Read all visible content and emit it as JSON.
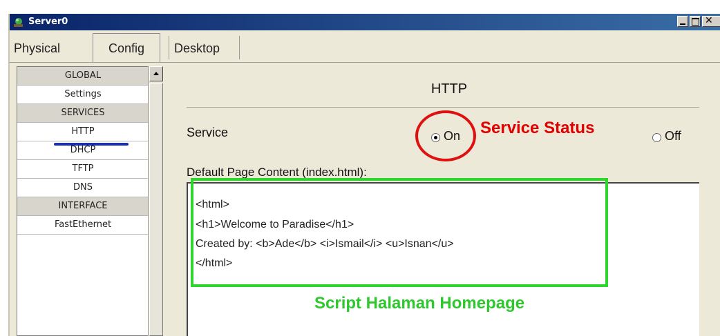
{
  "window": {
    "title": "Server0",
    "icon": "server-icon",
    "controls": [
      "minimize-icon",
      "maximize-icon",
      "close-icon"
    ]
  },
  "tabs": [
    {
      "label": "Physical",
      "active": false
    },
    {
      "label": "Config",
      "active": true
    },
    {
      "label": "Desktop",
      "active": false
    }
  ],
  "sidebar": {
    "items": [
      {
        "label": "GLOBAL",
        "type": "header"
      },
      {
        "label": "Settings",
        "type": "item"
      },
      {
        "label": "SERVICES",
        "type": "header"
      },
      {
        "label": "HTTP",
        "type": "item",
        "selected": true
      },
      {
        "label": "DHCP",
        "type": "item"
      },
      {
        "label": "TFTP",
        "type": "item"
      },
      {
        "label": "DNS",
        "type": "item"
      },
      {
        "label": "INTERFACE",
        "type": "header"
      },
      {
        "label": "FastEthernet",
        "type": "item"
      }
    ]
  },
  "panel": {
    "title": "HTTP",
    "service_label": "Service",
    "on_label": "On",
    "off_label": "Off",
    "service_state": "On",
    "content_label": "Default Page Content (index.html):",
    "content_lines": [
      "<html>",
      "<h1>Welcome to Paradise</h1>",
      "Created by: <b>Ade</b> <i>Ismail</i> <u>Isnan</u>",
      "</html>"
    ]
  },
  "annotations": {
    "service_status": "Service Status",
    "script_homepage": "Script Halaman Homepage",
    "colors": {
      "red": "#e00000",
      "green": "#2ec82e",
      "blue": "#1a2fb5"
    }
  }
}
